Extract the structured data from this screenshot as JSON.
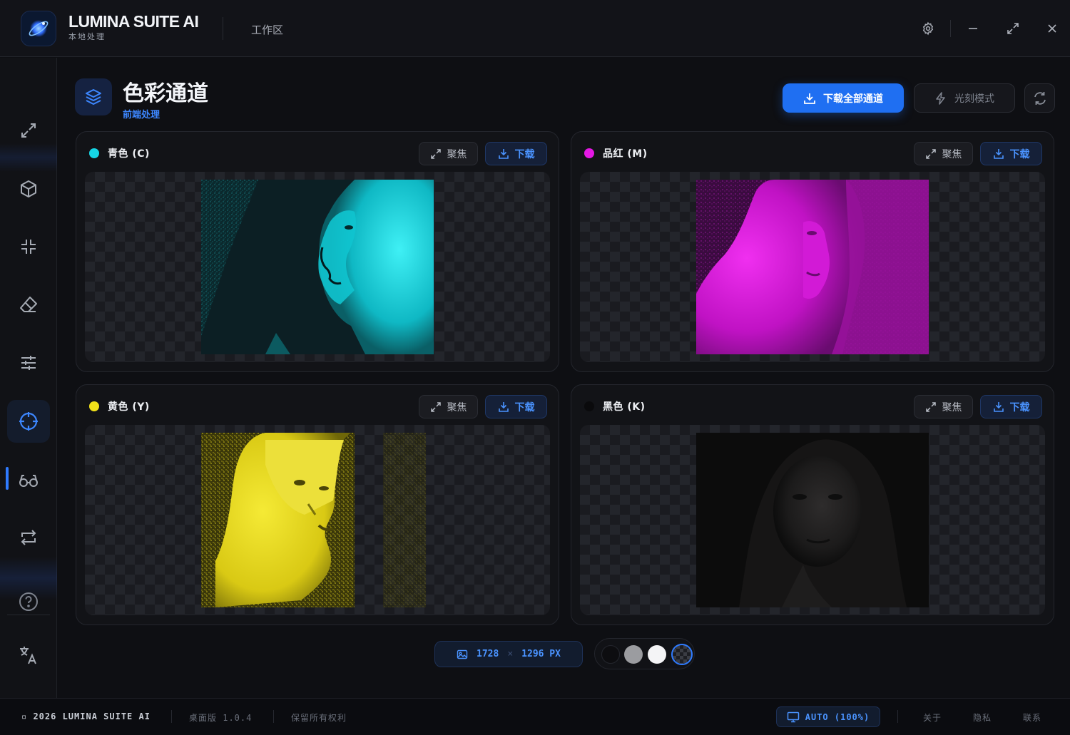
{
  "app": {
    "name": "LUMINA SUITE AI",
    "subtitle": "本地处理",
    "workspace_label": "工作区"
  },
  "header": {
    "title": "色彩通道",
    "subtitle": "前端处理",
    "download_all_label": "下载全部通道",
    "engrave_mode_label": "光刻模式"
  },
  "channels": [
    {
      "label": "青色 (C)",
      "dot_color": "#16d6e6",
      "focus_label": "聚焦",
      "download_label": "下载"
    },
    {
      "label": "品红 (M)",
      "dot_color": "#e418e4",
      "focus_label": "聚焦",
      "download_label": "下载"
    },
    {
      "label": "黄色 (Y)",
      "dot_color": "#f2e21a",
      "focus_label": "聚焦",
      "download_label": "下载"
    },
    {
      "label": "黑色 (K)",
      "dot_color": "#0a0a0c",
      "focus_label": "聚焦",
      "download_label": "下载"
    }
  ],
  "image_size": {
    "width": "1728",
    "separator": "×",
    "height": "1296 PX"
  },
  "background_swatches": [
    {
      "name": "black",
      "color": "#0d0d10"
    },
    {
      "name": "gray",
      "color": "#9b9ca0"
    },
    {
      "name": "white",
      "color": "#f4f4f6"
    },
    {
      "name": "checker",
      "color": "#2b2d33",
      "selected": true
    }
  ],
  "sidebar": {
    "items": [
      {
        "name": "expand-icon"
      },
      {
        "name": "cube-icon"
      },
      {
        "name": "compress-icon"
      },
      {
        "name": "eraser-icon"
      },
      {
        "name": "sliders-icon"
      },
      {
        "name": "crosshair-icon",
        "active": true
      },
      {
        "name": "glasses-icon"
      },
      {
        "name": "swap-icon"
      },
      {
        "name": "help-icon"
      },
      {
        "name": "translate-icon"
      }
    ]
  },
  "footer": {
    "copyright": "▫ 2026 LUMINA SUITE AI",
    "version": "桌面版 1.0.4",
    "rights": "保留所有权利",
    "display_mode": "AUTO (100%)",
    "about": "关于",
    "privacy": "隐私",
    "contact": "联系"
  },
  "colors": {
    "accent": "#1f6ff2",
    "cyan": "#16d6e6",
    "magenta": "#e418e4",
    "yellow": "#f2e21a"
  }
}
